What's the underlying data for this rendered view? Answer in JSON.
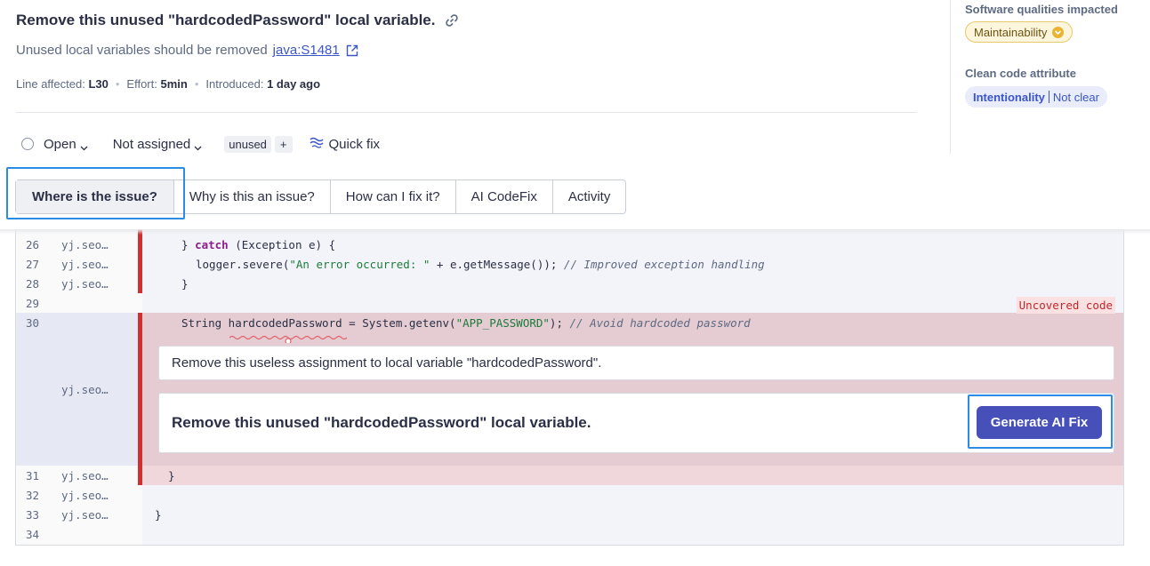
{
  "issue": {
    "title": "Remove this unused \"hardcodedPassword\" local variable.",
    "rule_text": "Unused local variables should be removed",
    "rule_key": "java:S1481",
    "line_label": "Line affected:",
    "line_value": "L30",
    "effort_label": "Effort:",
    "effort_value": "5min",
    "introduced_label": "Introduced:",
    "introduced_value": "1 day ago"
  },
  "actions": {
    "status": "Open",
    "assignee": "Not assigned",
    "tag": "unused",
    "tag_add": "+",
    "quick_fix": "Quick fix"
  },
  "sidebar": {
    "qualities_heading": "Software qualities impacted",
    "quality": "Maintainability",
    "quality_color": "#e8b431",
    "clean_code_heading": "Clean code attribute",
    "attribute": "Intentionality",
    "attribute_detail": "Not clear"
  },
  "tabs": [
    {
      "label": "Where is the issue?",
      "active": true
    },
    {
      "label": "Why is this an issue?",
      "active": false
    },
    {
      "label": "How can I fix it?",
      "active": false
    },
    {
      "label": "AI CodeFix",
      "active": false
    },
    {
      "label": "Activity",
      "active": false
    }
  ],
  "code": {
    "lines": [
      {
        "n": "26",
        "author": "yj.seo…"
      },
      {
        "n": "27",
        "author": "yj.seo…"
      },
      {
        "n": "28",
        "author": "yj.seo…"
      },
      {
        "n": "29",
        "author": ""
      },
      {
        "n": "30",
        "author": ""
      },
      {
        "n": "31",
        "author": "yj.seo…"
      },
      {
        "n": "32",
        "author": "yj.seo…"
      },
      {
        "n": "33",
        "author": "yj.seo…"
      },
      {
        "n": "34",
        "author": ""
      }
    ],
    "issue_author": "yj.seo…",
    "src26_a": "} ",
    "src26_kw": "catch",
    "src26_b": " (Exception e) {",
    "src27_a": "logger.severe(",
    "src27_str": "\"An error occurred: \"",
    "src27_b": " + e.getMessage()); ",
    "src27_cmt": "// Improved exception handling",
    "src28": "}",
    "src30_a": "String hardcodedPassword = System.getenv(",
    "src30_str": "\"APP_PASSWORD\"",
    "src30_b": "); ",
    "src30_cmt": "// Avoid hardcoded password",
    "src31": "}",
    "src33": "}",
    "uncovered": "Uncovered code",
    "secondary_message": "Remove this useless assignment to local variable \"hardcodedPassword\".",
    "primary_message": "Remove this unused \"hardcodedPassword\" local variable.",
    "generate_button": "Generate AI Fix"
  }
}
